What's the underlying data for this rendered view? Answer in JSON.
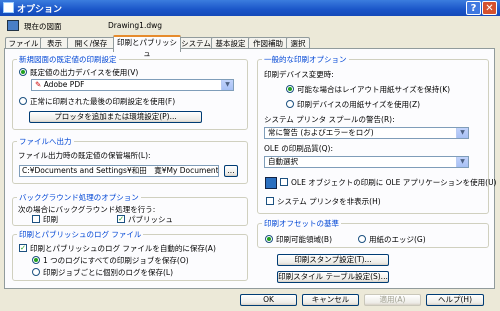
{
  "window": {
    "title": "オプション",
    "help_glyph": "?",
    "close_glyph": "✕"
  },
  "profile": {
    "current_drawing_label": "現在の図面",
    "drawing_name": "Drawing1.dwg"
  },
  "tabs": [
    "ファイル",
    "表示",
    "開く/保存",
    "印刷とパブリッシュ",
    "システム",
    "基本設定",
    "作図補助",
    "選択"
  ],
  "new_drawing_group": {
    "legend": "新規図面の既定値の印刷設定",
    "radio_default_device": "既定値の出力デバイスを使用(V)",
    "device_value": "Adobe PDF",
    "radio_last_applied": "正常に印刷された最後の印刷設定を使用(F)",
    "add_plotter_button": "プロッタを追加または環境設定(P)..."
  },
  "plot_to_file_group": {
    "legend": "ファイルへ出力",
    "location_label": "ファイル出力時の既定値の保管場所(L):",
    "location_value": "C:¥Documents and Settings¥和田　寛¥My Documents",
    "browse_button": "..."
  },
  "background_group": {
    "legend": "バックグラウンド処理のオプション",
    "description": "次の場合にバックグラウンド処理を行う:",
    "plotting_label": "印刷",
    "publishing_label": "パブリッシュ"
  },
  "log_group": {
    "legend": "印刷とパブリッシュのログ ファイル",
    "auto_save_label": "印刷とパブリッシュのログ ファイルを自動的に保存(A)",
    "continuous_log_label": "1 つのログにすべての印刷ジョブを保存(O)",
    "per_plot_log_label": "印刷ジョブごとに個別のログを保存(L)"
  },
  "general_group": {
    "legend": "一般的な印刷オプション",
    "device_change_label": "印刷デバイス変更時:",
    "keep_layout_size": "可能な場合はレイアウト用紙サイズを保持(K)",
    "use_device_size": "印刷デバイスの用紙サイズを使用(Z)",
    "spool_alert_label": "システム プリンタ スプールの警告(R):",
    "spool_alert_value": "常に警告 (およびエラーをログ)",
    "ole_quality_label": "OLE の印刷品質(Q):",
    "ole_quality_value": "自動選択",
    "ole_app_label": "OLE オブジェクトの印刷に OLE アプリケーションを使用(U)",
    "hide_system_printers_label": "システム プリンタを非表示(H)"
  },
  "offset_group": {
    "legend": "印刷オフセットの基準",
    "printable_area": "印刷可能領域(B)",
    "paper_edge": "用紙のエッジ(G)"
  },
  "stamp_button": "印刷スタンプ設定(T)...",
  "style_table_button": "印刷スタイル テーブル設定(S)...",
  "footer": {
    "ok": "OK",
    "cancel": "キャンセル",
    "apply": "適用(A)",
    "help": "ヘルプ(H)"
  }
}
